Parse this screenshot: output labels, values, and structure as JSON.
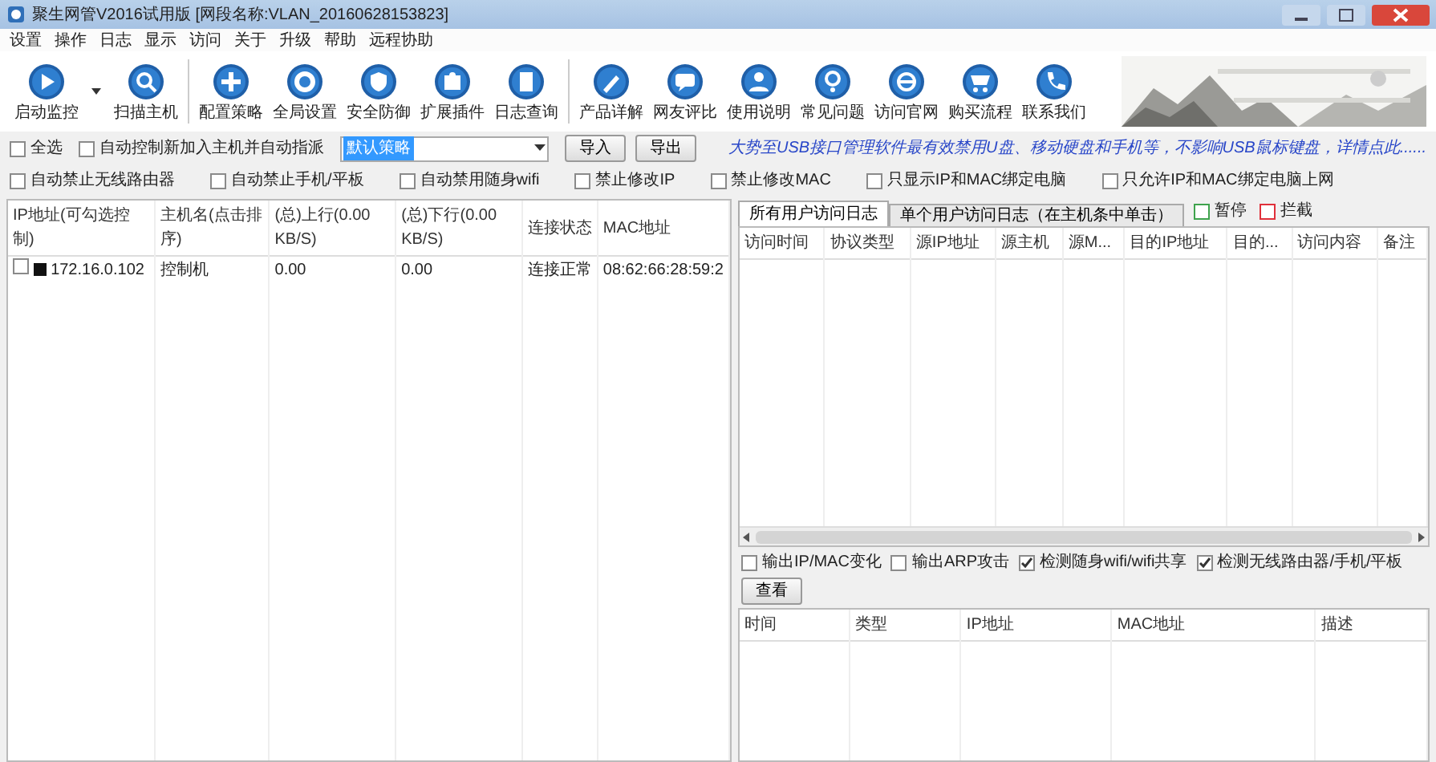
{
  "window": {
    "title": "聚生网管V2016试用版 [网段名称:VLAN_20160628153823]"
  },
  "menu": [
    "设置",
    "操作",
    "日志",
    "显示",
    "访问",
    "关于",
    "升级",
    "帮助",
    "远程协助"
  ],
  "toolbar_groups": [
    [
      "启动监控",
      "扫描主机"
    ],
    [
      "配置策略",
      "全局设置",
      "安全防御",
      "扩展插件",
      "日志查询"
    ],
    [
      "产品详解",
      "网友评比",
      "使用说明",
      "常见问题",
      "访问官网",
      "购买流程",
      "联系我们"
    ]
  ],
  "options_row": {
    "select_all": {
      "label": "全选",
      "checked": false
    },
    "auto_control": {
      "label": "自动控制新加入主机并自动指派",
      "checked": false
    },
    "policy_select": {
      "value": "默认策略"
    },
    "buttons": [
      "导入",
      "导出"
    ],
    "promo_text": "大势至USB接口管理软件最有效禁用U盘、移动硬盘和手机等，不影响USB鼠标键盘，详情点此......"
  },
  "auto_options": [
    {
      "label": "自动禁止无线路由器",
      "checked": false
    },
    {
      "label": "自动禁止手机/平板",
      "checked": false
    },
    {
      "label": "自动禁用随身wifi",
      "checked": false
    },
    {
      "label": "禁止修改IP",
      "checked": false
    },
    {
      "label": "禁止修改MAC",
      "checked": false
    },
    {
      "label": "只显示IP和MAC绑定电脑",
      "checked": false
    },
    {
      "label": "只允许IP和MAC绑定电脑上网",
      "checked": false
    }
  ],
  "hosts_table": {
    "columns": [
      "IP地址(可勾选控制)",
      "主机名(点击排序)",
      "(总)上行(0.00 KB/S)",
      "(总)下行(0.00 KB/S)",
      "连接状态",
      "MAC地址"
    ],
    "rows": [
      {
        "checked": false,
        "cells": [
          "172.16.0.102",
          "控制机",
          "0.00",
          "0.00",
          "连接正常",
          "08:62:66:28:59:2"
        ]
      }
    ]
  },
  "log_tabs": [
    {
      "label": "所有用户访问日志",
      "selected": true
    },
    {
      "label": "单个用户访问日志（在主机条中单击）",
      "selected": false
    }
  ],
  "log_options": [
    {
      "label": "暂停",
      "checked": false,
      "color": "#3fa34d"
    },
    {
      "label": "拦截",
      "checked": false,
      "color": "#e0303a"
    }
  ],
  "access_log_table": {
    "columns": [
      "访问时间",
      "协议类型",
      "源IP地址",
      "源主机",
      "源M...",
      "目的IP地址",
      "目的...",
      "访问内容",
      "备注"
    ]
  },
  "event_options": [
    {
      "label": "输出IP/MAC变化",
      "checked": false
    },
    {
      "label": "输出ARP攻击",
      "checked": false
    },
    {
      "label": "检测随身wifi/wifi共享",
      "checked": true
    },
    {
      "label": "检测无线路由器/手机/平板",
      "checked": true
    }
  ],
  "event_button": "查看",
  "event_table": {
    "columns": [
      "时间",
      "类型",
      "IP地址",
      "MAC地址",
      "描述"
    ]
  }
}
